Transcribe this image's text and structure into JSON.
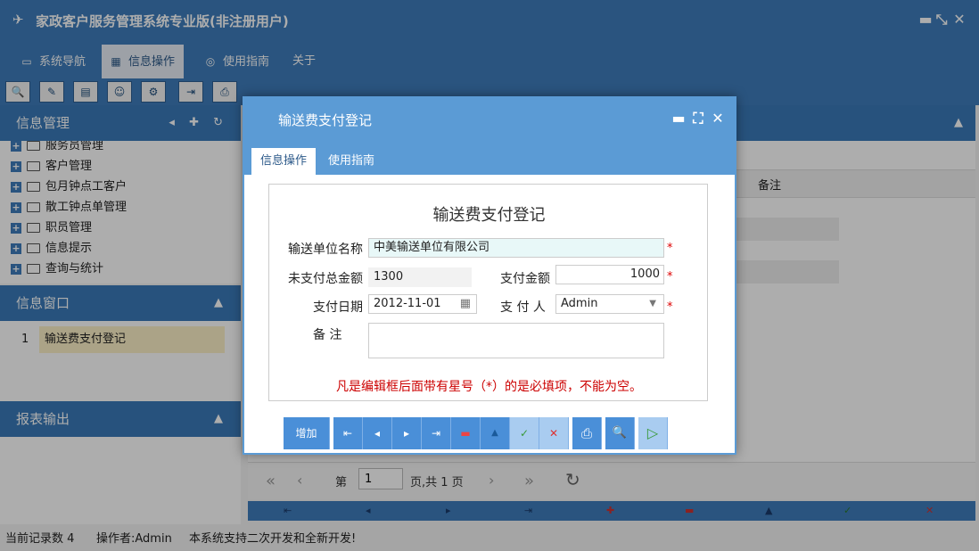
{
  "app": {
    "title": "家政客户服务管理系统专业版(非注册用户)",
    "logo_icon": "bird-logo-icon"
  },
  "window_controls": {
    "minimize": "▬",
    "restore": "⤡",
    "close": "✕"
  },
  "menu": [
    {
      "label": "系统导航",
      "icon": "monitor-icon",
      "active": false
    },
    {
      "label": "信息操作",
      "icon": "grid-icon",
      "active": true
    },
    {
      "label": "使用指南",
      "icon": "compass-icon",
      "active": false
    },
    {
      "label": "关于",
      "icon": "",
      "active": false
    }
  ],
  "toolbar": {
    "icons": [
      "search-icon",
      "edit-icon",
      "document-icon",
      "users-icon",
      "settings-icon",
      "export-icon",
      "print-icon"
    ]
  },
  "sidebar": {
    "info_mgmt": {
      "title": "信息管理",
      "tools": "◂ ✚ ↻"
    },
    "tree": [
      {
        "label": "服务员管理"
      },
      {
        "label": "客户管理"
      },
      {
        "label": "包月钟点工客户"
      },
      {
        "label": "散工钟点单管理"
      },
      {
        "label": "职员管理"
      },
      {
        "label": "信息提示"
      },
      {
        "label": "查询与统计"
      }
    ],
    "info_window": {
      "title": "信息窗口",
      "collapse": "▲",
      "rows": [
        {
          "num": "1",
          "label": "输送费支付登记"
        }
      ]
    },
    "report": {
      "title": "报表输出",
      "collapse": "▲"
    }
  },
  "main": {
    "collapse": "▲",
    "column_note": "备注",
    "pager": {
      "first": "«",
      "prev": "‹",
      "page_label": "第",
      "page_value": "1",
      "total": "页,共 1 页",
      "next": "›",
      "last": "»",
      "refresh": "↻"
    },
    "bottom_icons": [
      "⇤",
      "◂",
      "▸",
      "⇥",
      "✚",
      "▬",
      "▲",
      "✓",
      "✕"
    ]
  },
  "status": {
    "records": "当前记录数 4",
    "operator": "操作者:Admin",
    "message": "本系统支持二次开发和全新开发!"
  },
  "dialog": {
    "title": "输送费支付登记",
    "controls": {
      "minimize": "▬",
      "maximize": "⛶",
      "close": "✕"
    },
    "tabs": [
      {
        "label": "信息操作",
        "active": true
      },
      {
        "label": "使用指南",
        "active": false
      }
    ],
    "form": {
      "title": "输送费支付登记",
      "unit_label": "输送单位名称",
      "unit_value": "中美输送单位有限公司",
      "unpaid_label": "未支付总金额",
      "unpaid_value": "1300",
      "pay_amount_label": "支付金额",
      "pay_amount_value": "1000",
      "pay_date_label": "支付日期",
      "pay_date_value": "2012-11-01",
      "payer_label": "支 付 人",
      "payer_value": "Admin",
      "note_label": "备 注",
      "note_value": "",
      "required_mark": "*",
      "notice": "凡是编辑框后面带有星号（*）的是必填项，不能为空。"
    },
    "buttons": {
      "add": "增加",
      "first": "⇤",
      "prev": "◂",
      "next": "▸",
      "last": "⇥",
      "delete": "▬",
      "up": "▲",
      "confirm": "✓",
      "cancel": "✕",
      "print": "⎙",
      "preview": "🔍",
      "run": "▷"
    }
  }
}
